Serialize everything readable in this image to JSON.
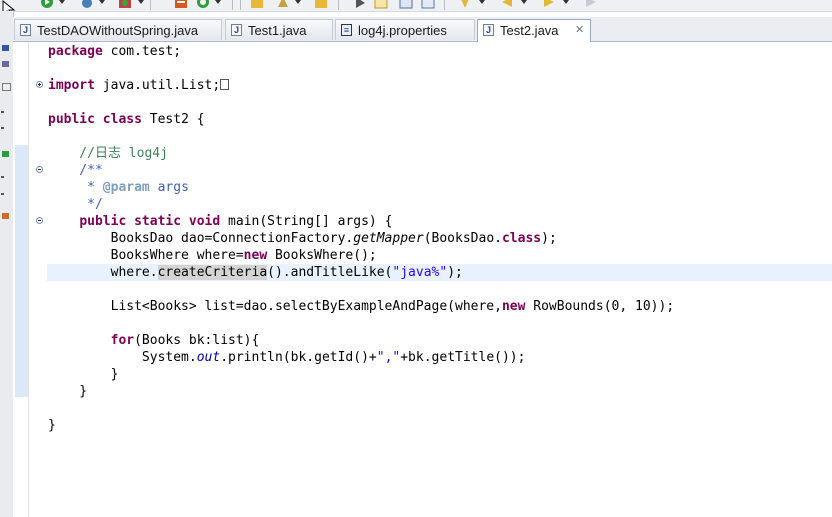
{
  "toolbar": {
    "icons": [
      "run-icon",
      "debug-icon",
      "external-tools-icon",
      "new-server-icon",
      "refresh-icon",
      "open-folder-icon",
      "build-icon",
      "open-file-icon",
      "run-last-icon",
      "edit-icon",
      "task-list-icon",
      "navigate-icon",
      "annotation-icon",
      "back-icon",
      "forward-icon"
    ]
  },
  "tabs": [
    {
      "label": "TestDAOWithoutSpring.java",
      "icon": "java-file-icon",
      "active": false
    },
    {
      "label": "Test1.java",
      "icon": "java-file-icon",
      "active": false
    },
    {
      "label": "log4j.properties",
      "icon": "properties-file-icon",
      "active": false
    },
    {
      "label": "Test2.java",
      "icon": "java-file-icon",
      "active": true,
      "close": "✕"
    }
  ],
  "code": {
    "l1_kw": "package",
    "l1_rest": " com.test;",
    "l2_kw": "import",
    "l2_rest": " java.util.List;",
    "l3_kw1": "public",
    "l3_kw2": "class",
    "l3_rest": " Test2 {",
    "l4": "    //日志 log4j",
    "l5": "    /**",
    "l6_a": "     * ",
    "l6_tag": "@param",
    "l6_b": " args",
    "l7": "     */",
    "l8_kw1": "public",
    "l8_kw2": "static",
    "l8_kw3": "void",
    "l8_rest": " main(String[] args) {",
    "l9_a": "        BooksDao dao=ConnectionFactory.",
    "l9_it": "getMapper",
    "l9_b": "(BooksDao.",
    "l9_kw": "class",
    "l9_c": ");",
    "l10_a": "        BooksWhere where=",
    "l10_kw": "new",
    "l10_b": " BooksWhere();",
    "l11_a": "        where.",
    "l11_hl": "createCriteria",
    "l11_b": "().andTitleLike(",
    "l11_str": "\"java%\"",
    "l11_c": ");",
    "l12_a": "        List<Books> list=dao.selectByExampleAndPage(where,",
    "l12_kw": "new",
    "l12_b": " RowBounds(0, 10));",
    "l13_kw": "for",
    "l13_rest": "(Books bk:list){",
    "l14_a": "            System.",
    "l14_fld": "out",
    "l14_b": ".println(bk.getId()+",
    "l14_str": "\",\"",
    "l14_c": "+bk.getTitle());",
    "l15": "        }",
    "l16": "    }",
    "l17": "}"
  }
}
